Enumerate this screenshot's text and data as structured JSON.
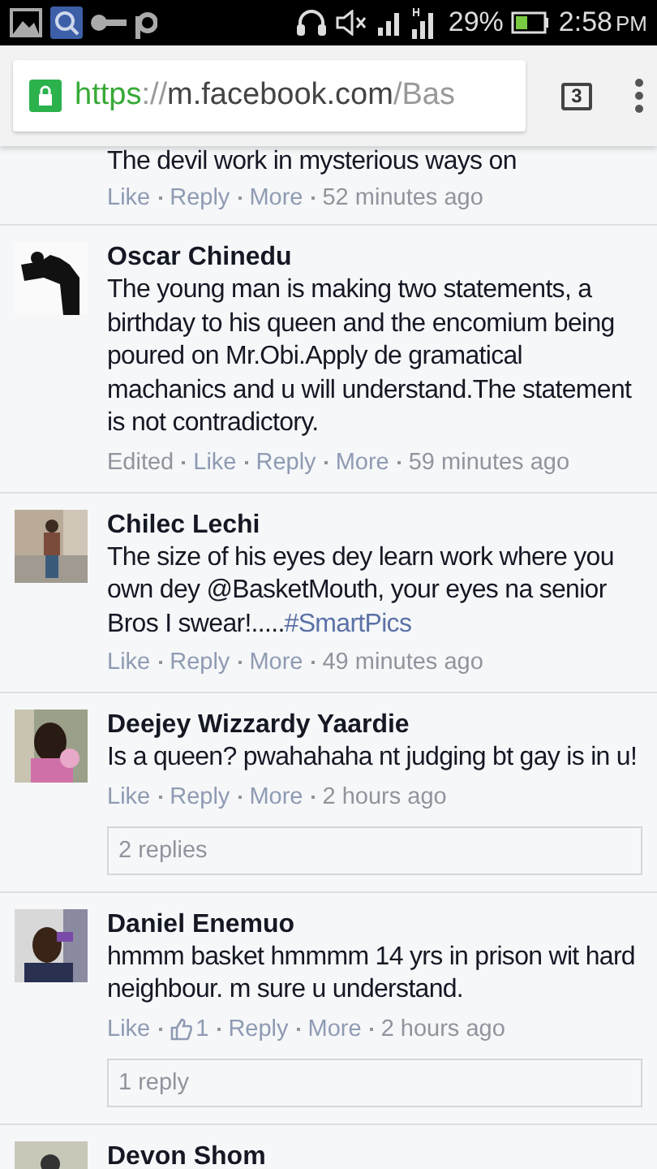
{
  "status_bar": {
    "battery": "29%",
    "time": "2:58",
    "meridiem": "PM"
  },
  "address_bar": {
    "url": {
      "scheme": "https",
      "separator": "://",
      "host": "m.facebook.com",
      "path": "/Bas"
    },
    "tab_count": "3"
  },
  "partial_comment": {
    "text": "The devil work in mysterious ways on",
    "actions": [
      {
        "kind": "link",
        "label": "Like"
      },
      {
        "kind": "link",
        "label": "Reply"
      },
      {
        "kind": "link",
        "label": "More"
      },
      {
        "kind": "time",
        "label": "52 minutes ago"
      }
    ]
  },
  "comments": [
    {
      "author": "Oscar Chinedu",
      "avatar": {
        "kind": "picture"
      },
      "text": "The young man is making two statements, a birthday to his queen and the encomium being poured on Mr.Obi.Apply de gramatical machanics and u will understand.The statement is not contradictory.",
      "actions": [
        {
          "kind": "label",
          "label": "Edited"
        },
        {
          "kind": "link",
          "label": "Like"
        },
        {
          "kind": "link",
          "label": "Reply"
        },
        {
          "kind": "link",
          "label": "More"
        },
        {
          "kind": "time",
          "label": "59 minutes ago"
        }
      ]
    },
    {
      "author": "Chilec Lechi",
      "avatar": {
        "kind": "picture"
      },
      "text": "The size of his eyes dey learn work where you own dey @BasketMouth, your eyes na senior Bros I swear!.....",
      "hashtag": "#SmartPics",
      "actions": [
        {
          "kind": "link",
          "label": "Like"
        },
        {
          "kind": "link",
          "label": "Reply"
        },
        {
          "kind": "link",
          "label": "More"
        },
        {
          "kind": "time",
          "label": "49 minutes ago"
        }
      ]
    },
    {
      "author": "Deejey Wizzardy Yaardie",
      "avatar": {
        "kind": "picture"
      },
      "text": "Is a queen? pwahahaha nt judging bt gay is in u!",
      "actions": [
        {
          "kind": "link",
          "label": "Like"
        },
        {
          "kind": "link",
          "label": "Reply"
        },
        {
          "kind": "link",
          "label": "More"
        },
        {
          "kind": "time",
          "label": "2 hours ago"
        }
      ],
      "replies": "2 replies"
    },
    {
      "author": "Daniel Enemuo",
      "avatar": {
        "kind": "picture"
      },
      "text": "hmmm basket hmmmm 14 yrs in prison wit hard neighbour. m sure u understand.",
      "actions": [
        {
          "kind": "link",
          "label": "Like"
        },
        {
          "kind": "likes",
          "label": "1"
        },
        {
          "kind": "link",
          "label": "Reply"
        },
        {
          "kind": "link",
          "label": "More"
        },
        {
          "kind": "time",
          "label": "2 hours ago"
        }
      ],
      "replies": "1 reply"
    },
    {
      "author": "Devon Shom",
      "avatar": {
        "kind": "picture"
      }
    }
  ]
}
